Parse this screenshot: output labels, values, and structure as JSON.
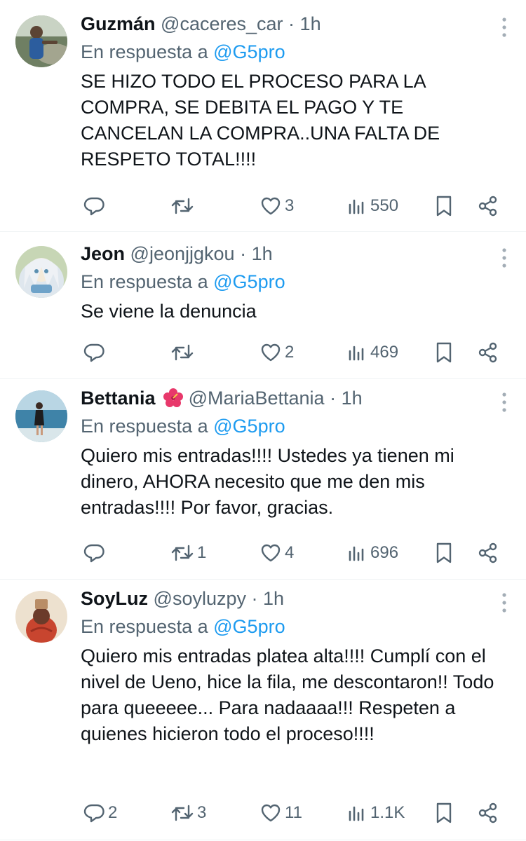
{
  "reply_prefix": "En respuesta a",
  "tweets": [
    {
      "name": "Guzmán",
      "handle": "@caceres_car",
      "separator": "·",
      "time": "1h",
      "reply_to": "@G5pro",
      "text": "SE HIZO TODO EL PROCESO PARA LA COMPRA, SE DEBITA EL PAGO Y TE CANCELAN LA COMPRA..UNA FALTA DE RESPETO TOTAL!!!!",
      "replies": "",
      "retweets": "",
      "likes": "3",
      "views": "550"
    },
    {
      "name": "Jeon",
      "handle": "@jeonjjgkou",
      "separator": "·",
      "time": "1h",
      "reply_to": "@G5pro",
      "text": "Se viene la denuncia",
      "replies": "",
      "retweets": "",
      "likes": "2",
      "views": "469"
    },
    {
      "name": "Bettania",
      "name_emoji": "hibiscus-emoji",
      "handle": "@MariaBettania",
      "separator": "·",
      "time": "1h",
      "reply_to": "@G5pro",
      "text": "Quiero mis entradas!!!! Ustedes ya tienen mi dinero, AHORA necesito que me den mis entradas!!!! Por favor, gracias.",
      "replies": "",
      "retweets": "1",
      "likes": "4",
      "views": "696"
    },
    {
      "name": "SoyLuz",
      "handle": "@soyluzpy",
      "separator": "·",
      "time": "1h",
      "reply_to": "@G5pro",
      "text": "Quiero mis entradas platea alta!!!! Cumplí con el nivel de Ueno, hice la fila, me descontaron!! Todo para queeeee... Para nadaaaa!!! Respeten a quienes hicieron todo el proceso!!!!",
      "replies": "2",
      "retweets": "3",
      "likes": "11",
      "views": "1.1K"
    }
  ],
  "colors": {
    "text": "#0f1419",
    "secondary": "#536471",
    "link": "#1d9bf0",
    "divider": "#eff3f4"
  },
  "icons": {
    "reply": "reply-icon",
    "retweet": "retweet-icon",
    "like": "heart-icon",
    "views": "views-icon",
    "bookmark": "bookmark-icon",
    "share": "share-icon",
    "more": "more-icon"
  }
}
